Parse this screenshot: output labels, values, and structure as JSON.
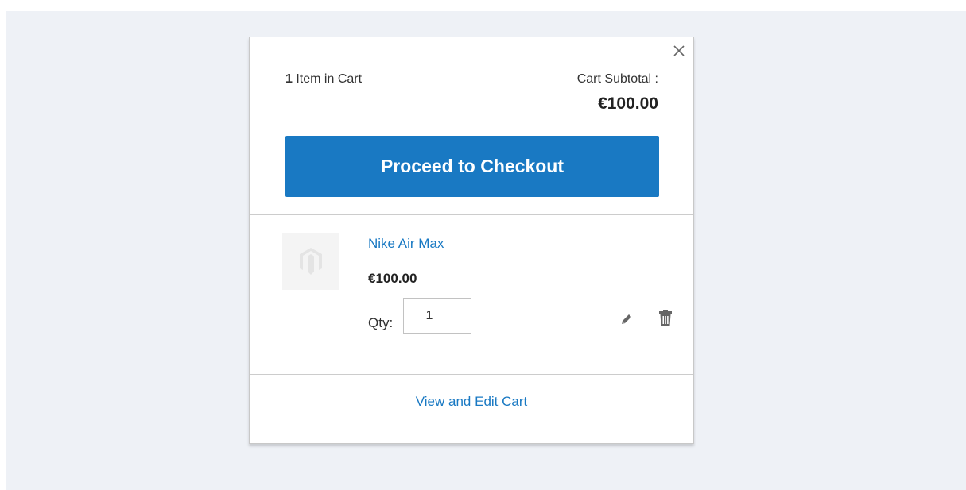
{
  "minicart": {
    "close_label": "×",
    "items_count": "1",
    "items_label": "Item in Cart",
    "subtotal_label": "Cart Subtotal :",
    "subtotal_amount": "€100.00",
    "checkout_label": "Proceed to Checkout",
    "view_edit_label": "View and Edit Cart"
  },
  "item": {
    "name": "Nike Air Max",
    "price": "€100.00",
    "qty_label": "Qty:",
    "qty_value": "1",
    "thumbnail_icon": "magento-logo-icon",
    "edit_icon": "pencil-icon",
    "delete_icon": "trash-icon"
  },
  "colors": {
    "accent": "#1979c3",
    "backdrop": "#eef1f6"
  }
}
